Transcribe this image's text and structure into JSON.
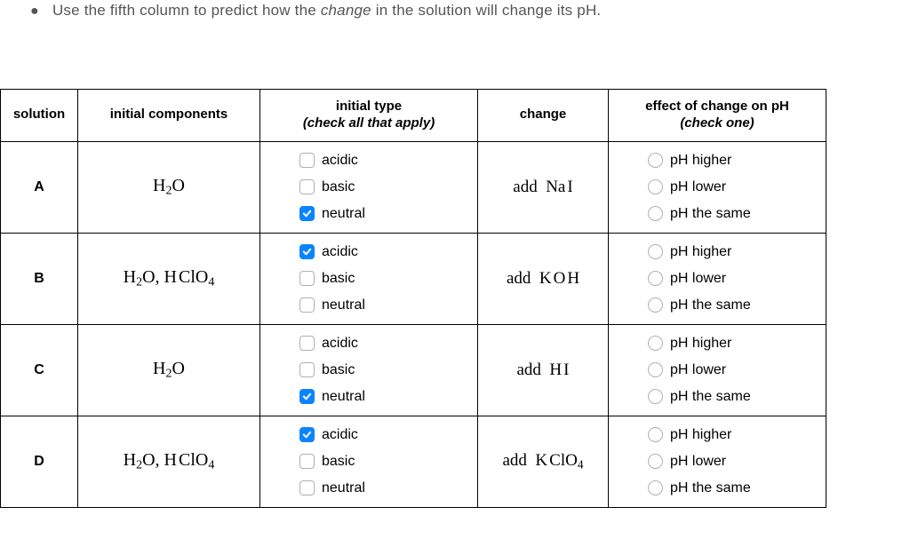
{
  "instruction": {
    "prefix": "Use the fifth column to predict how the ",
    "italic": "change",
    "suffix": " in the solution will change its pH."
  },
  "headers": {
    "solution": "solution",
    "components": "initial components",
    "initial_type_line1": "initial type",
    "initial_type_line2": "(check all that apply)",
    "change": "change",
    "effect_line1": "effect of change on pH",
    "effect_line2": "(check one)"
  },
  "type_options": {
    "acidic": "acidic",
    "basic": "basic",
    "neutral": "neutral"
  },
  "effect_options": {
    "higher": "pH higher",
    "lower": "pH lower",
    "same": "pH the same"
  },
  "rows": [
    {
      "label": "A",
      "components_html": "H<sub>2</sub>O",
      "type_checked": {
        "acidic": false,
        "basic": false,
        "neutral": true
      },
      "change_html": "add&nbsp;&nbsp;Na<span class='sp'></span>I",
      "effect_selected": null
    },
    {
      "label": "B",
      "components_html": "H<sub>2</sub>O, H<span class='sp'></span>ClO<sub>4</sub>",
      "type_checked": {
        "acidic": true,
        "basic": false,
        "neutral": false
      },
      "change_html": "add&nbsp;&nbsp;K<span class='sp'></span>O<span class='sp'></span>H",
      "effect_selected": null
    },
    {
      "label": "C",
      "components_html": "H<sub>2</sub>O",
      "type_checked": {
        "acidic": false,
        "basic": false,
        "neutral": true
      },
      "change_html": "add&nbsp;&nbsp;H<span class='sp'></span>I",
      "effect_selected": null
    },
    {
      "label": "D",
      "components_html": "H<sub>2</sub>O, H<span class='sp'></span>ClO<sub>4</sub>",
      "type_checked": {
        "acidic": true,
        "basic": false,
        "neutral": false
      },
      "change_html": "add&nbsp;&nbsp;K<span class='sp'></span>ClO<sub>4</sub>",
      "effect_selected": null
    }
  ]
}
